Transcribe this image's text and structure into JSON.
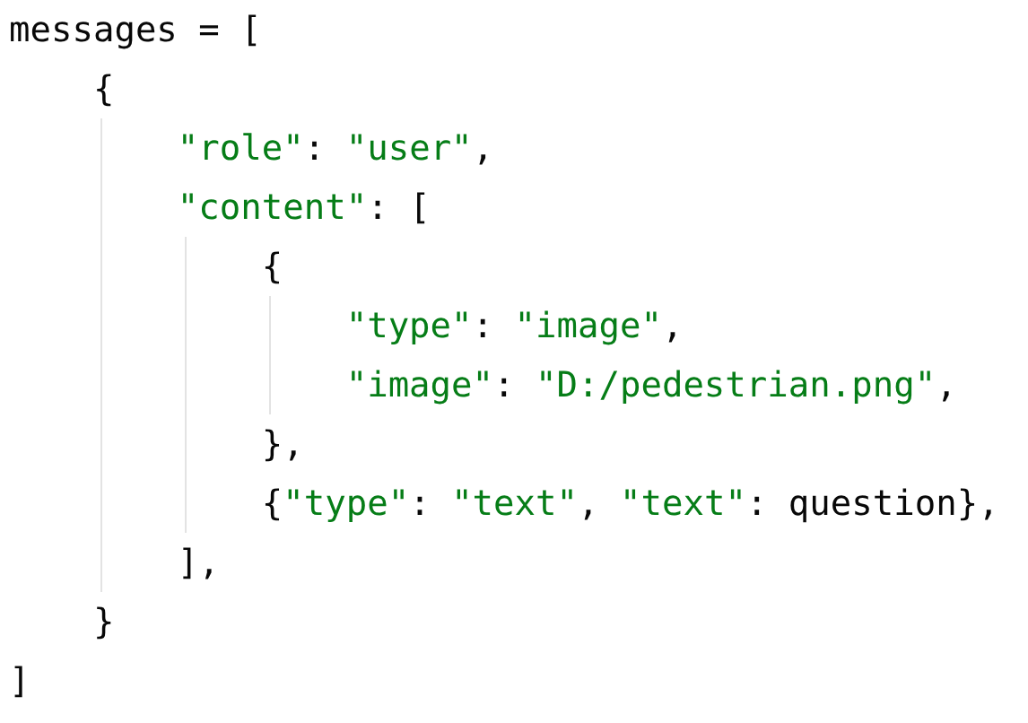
{
  "code": {
    "lines": [
      [
        {
          "kind": "plain",
          "text": "messages = ["
        }
      ],
      [
        {
          "kind": "plain",
          "text": "    {"
        }
      ],
      [
        {
          "kind": "string",
          "text": "        \"role\""
        },
        {
          "kind": "plain",
          "text": ": "
        },
        {
          "kind": "string",
          "text": "\"user\""
        },
        {
          "kind": "plain",
          "text": ","
        }
      ],
      [
        {
          "kind": "string",
          "text": "        \"content\""
        },
        {
          "kind": "plain",
          "text": ": ["
        }
      ],
      [
        {
          "kind": "plain",
          "text": "            {"
        }
      ],
      [
        {
          "kind": "string",
          "text": "                \"type\""
        },
        {
          "kind": "plain",
          "text": ": "
        },
        {
          "kind": "string",
          "text": "\"image\""
        },
        {
          "kind": "plain",
          "text": ","
        }
      ],
      [
        {
          "kind": "string",
          "text": "                \"image\""
        },
        {
          "kind": "plain",
          "text": ": "
        },
        {
          "kind": "string",
          "text": "\"D:/pedestrian.png\""
        },
        {
          "kind": "plain",
          "text": ","
        }
      ],
      [
        {
          "kind": "plain",
          "text": "            },"
        }
      ],
      [
        {
          "kind": "plain",
          "text": "            {"
        },
        {
          "kind": "string",
          "text": "\"type\""
        },
        {
          "kind": "plain",
          "text": ": "
        },
        {
          "kind": "string",
          "text": "\"text\""
        },
        {
          "kind": "plain",
          "text": ", "
        },
        {
          "kind": "string",
          "text": "\"text\""
        },
        {
          "kind": "plain",
          "text": ": question},"
        }
      ],
      [
        {
          "kind": "plain",
          "text": "        ],"
        }
      ],
      [
        {
          "kind": "plain",
          "text": "    }"
        }
      ],
      [
        {
          "kind": "plain",
          "text": "]"
        }
      ]
    ]
  }
}
